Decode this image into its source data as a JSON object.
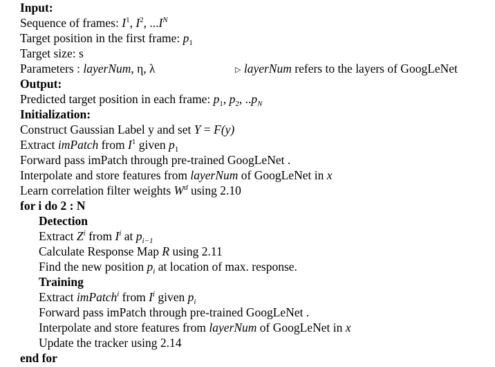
{
  "algorithm": {
    "input_label": "Input:",
    "seq_text": "Sequence of frames:",
    "seq_math": ", ...",
    "target_pos_text": "Target position in the first frame:",
    "target_size_text": "Target size: s",
    "params_text": "Parameters :",
    "params_eta_lambda": ", η, λ",
    "layernum": "layerNum",
    "comment_text": "refers to the layers of GoogLeNet",
    "output_label": "Output:",
    "predicted_text": "Predicted target position in each frame:",
    "init_label": "Initialization:",
    "construct_text": "Construct Gaussian Label y and set",
    "Y_math": "Y",
    "eq": " = ",
    "F_math": "F",
    "y_paren": "(y)",
    "extract_text": "Extract",
    "impatch": "imPatch",
    "from_text": "from",
    "given_text": "given",
    "forward_text": "Forward pass imPatch through pre-trained GoogLeNet .",
    "interp_text": "Interpolate and store features from",
    "of_googlenet_in": "of GoogLeNet in",
    "x_math": "x",
    "learn_text": "Learn correlation filter weights",
    "W_math": "W",
    "d_sup": "d",
    "using_210": "using 2.10",
    "for_text": "for i do 2 : N",
    "detection_label": "Detection",
    "Z_math": "Z",
    "i_sup": "i",
    "at_text": "at",
    "p_math": "p",
    "i_minus_1": "i−1",
    "calc_text": "Calculate Response Map",
    "R_math": "R",
    "using_211": "using 2.11",
    "find_text": "Find the new position",
    "at_max_text": "at location of max. response.",
    "training_label": "Training",
    "I_math": "I",
    "one_sup": "1",
    "two_sup": "2",
    "N_sup": "N",
    "one_sub": "1",
    "two_sub": "2",
    "N_sub": "N",
    "i_sub": "i",
    "comma": ",",
    "dotdot": ", ..",
    "update_text": "Update the tracker using 2.14",
    "endfor_text": "end for"
  }
}
